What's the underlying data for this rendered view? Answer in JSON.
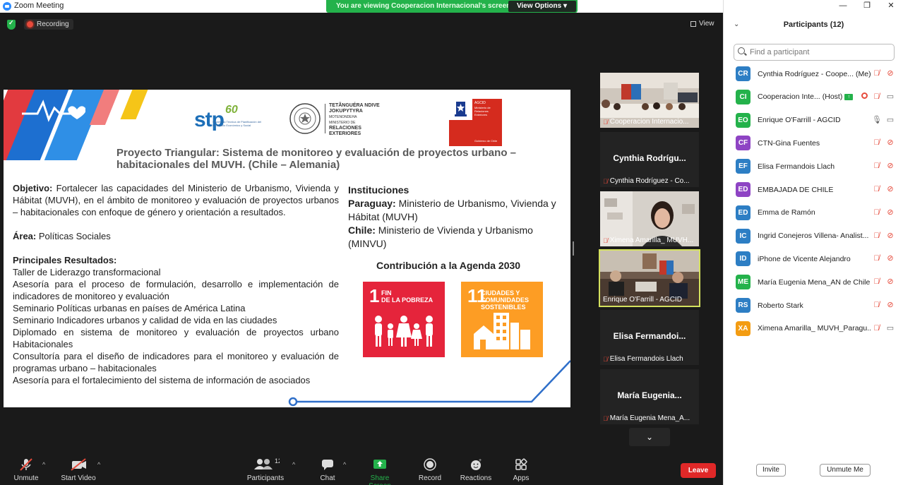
{
  "window": {
    "title": "Zoom Meeting"
  },
  "share_banner": {
    "message": "You are viewing Cooperacion Internacional's screen",
    "view_options": "View Options ▾"
  },
  "top": {
    "recording": "Recording",
    "view": "View"
  },
  "slide": {
    "logos": {
      "stp": "stp",
      "stp_sixty": "60",
      "stp_sub": "Secretaría Técnica de Planificación del Desarrollo Económico y Social",
      "mre_line1": "TETÃNGUÉRA NDIVE",
      "mre_line2": "JOKUPYTYRA",
      "mre_line3": "MOTENONDEHA",
      "mre_line4": "MINISTERIO DE",
      "mre_line5": "RELACIONES",
      "mre_line6": "EXTERIORES",
      "agcid_top": "AGCID",
      "agcid_sub": "Ministerio de Relaciones Exteriores",
      "agcid_gov": "Gobierno de Chile"
    },
    "title": "Proyecto Triangular: Sistema de monitoreo y evaluación de proyectos urbano – habitacionales del MUVH. (Chile – Alemania)",
    "objective_label": "Objetivo:",
    "objective_text": " Fortalecer las capacidades del Ministerio de Urbanismo, Vivienda y Hábitat (MUVH), en el ámbito de monitoreo y evaluación de proyectos urbanos – habitacionales con enfoque de género y orientación a resultados.",
    "area_label": "Área:",
    "area_text": " Políticas Sociales",
    "results_label": "Principales Resultados:",
    "results": [
      " Taller de Liderazgo transformacional",
      "Asesoría para el proceso de formulación, desarrollo e implementación de indicadores de monitoreo y evaluación",
      "Seminario Políticas urbanas en países de América Latina",
      "Seminario Indicadores urbanos y calidad de vida en las ciudades",
      "Diplomado en sistema de monitoreo y evaluación de proyectos urbano Habitacionales",
      "Consultoría para el diseño de indicadores para el monitoreo y evaluación de programas urbano – habitacionales",
      "Asesoría para el fortalecimiento del sistema de información de asociados"
    ],
    "institutions_label": "Instituciones",
    "paraguay_label": "Paraguay:",
    "paraguay_text": " Ministerio de Urbanismo, Vivienda y Hábitat (MUVH)",
    "chile_label": "Chile:",
    "chile_text": " Ministerio de Vivienda y Urbanismo (MINVU)",
    "agenda_title": "Contribución a la Agenda 2030",
    "sdg1": {
      "num": "1",
      "line1": "FIN",
      "line2": "DE LA POBREZA",
      "color": "#e5243b"
    },
    "sdg11": {
      "num": "11",
      "line1": "CIUDADES Y",
      "line2": "COMUNIDADES",
      "line3": "SOSTENIBLES",
      "color": "#fd9d24"
    }
  },
  "tiles": [
    {
      "name": "Cooperacion Internacio...",
      "type": "video"
    },
    {
      "name": "Cynthia Rodríguez - Co...",
      "big": "Cynthia  Rodrígu...",
      "type": "name"
    },
    {
      "name": "Ximena Amarilla_ MUVH...",
      "type": "video"
    },
    {
      "name": "Enrique O'Farrill - AGCID",
      "type": "video",
      "active": true
    },
    {
      "name": "Elisa Fermandois Llach",
      "big": "Elisa  Fermandoi...",
      "type": "name"
    },
    {
      "name": "María Eugenia Mena_A...",
      "big": "María  Eugenia...",
      "type": "name"
    }
  ],
  "toolbar": {
    "unmute": "Unmute",
    "start_video": "Start Video",
    "participants": "Participants",
    "participants_count": "12",
    "chat": "Chat",
    "share_screen": "Share Screen",
    "record": "Record",
    "reactions": "Reactions",
    "apps": "Apps",
    "leave": "Leave"
  },
  "panel": {
    "title": "Participants (12)",
    "search_placeholder": "Find a participant",
    "participants": [
      {
        "initials": "CR",
        "name": "Cynthia Rodríguez - Coope...",
        "role": "(Me)",
        "color": "#2d7ec4"
      },
      {
        "initials": "CI",
        "name": "Cooperacion Inte...",
        "role": "(Host)",
        "color": "#24b24b"
      },
      {
        "initials": "EO",
        "name": "Enrique O'Farrill - AGCID",
        "role": "",
        "color": "#24b24b"
      },
      {
        "initials": "CF",
        "name": "CTN-Gina Fuentes",
        "role": "",
        "color": "#8e44c4"
      },
      {
        "initials": "EF",
        "name": "Elisa Fermandois Llach",
        "role": "",
        "color": "#2d7ec4"
      },
      {
        "initials": "ED",
        "name": "EMBAJADA DE CHILE",
        "role": "",
        "color": "#8e44c4"
      },
      {
        "initials": "ED",
        "name": "Emma de Ramón",
        "role": "",
        "color": "#2d7ec4"
      },
      {
        "initials": "IC",
        "name": "Ingrid Conejeros Villena- Analist...",
        "role": "",
        "color": "#2d7ec4"
      },
      {
        "initials": "ID",
        "name": "iPhone de Vicente Alejandro",
        "role": "",
        "color": "#2d7ec4"
      },
      {
        "initials": "ME",
        "name": "María Eugenia Mena_AN de Chile",
        "role": "",
        "color": "#24b24b"
      },
      {
        "initials": "RS",
        "name": "Roberto Stark",
        "role": "",
        "color": "#2d7ec4"
      },
      {
        "initials": "XA",
        "name": "Ximena Amarilla_ MUVH_Paragu...",
        "role": "",
        "color": "#f39c12"
      }
    ],
    "invite": "Invite",
    "unmute_me": "Unmute Me"
  }
}
